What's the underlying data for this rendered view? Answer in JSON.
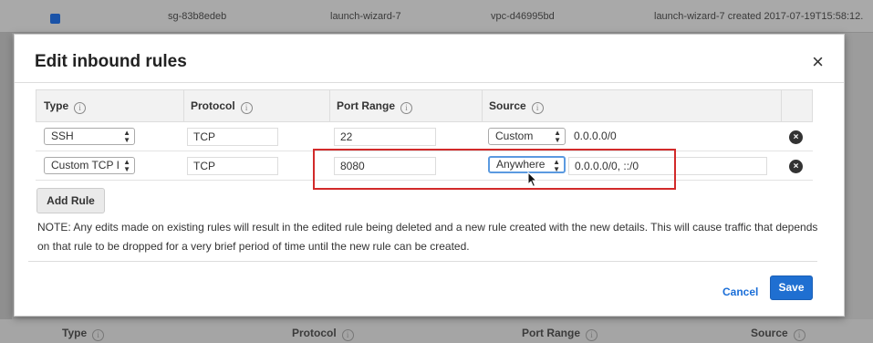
{
  "background": {
    "row": {
      "id": "sg-83b8edeb",
      "name": "launch-wizard-7",
      "vpc": "vpc-d46995bd",
      "description": "launch-wizard-7 created 2017-07-19T15:58:12."
    },
    "headers": [
      "Type",
      "Protocol",
      "Port Range",
      "Source"
    ]
  },
  "modal": {
    "title": "Edit inbound rules",
    "close_glyph": "×",
    "columns": [
      "Type",
      "Protocol",
      "Port Range",
      "Source"
    ],
    "info_glyph": "i",
    "rows": [
      {
        "type": "SSH",
        "protocol": "TCP",
        "port_range": "22",
        "source_type": "Custom",
        "source_value": "0.0.0.0/0"
      },
      {
        "type": "Custom TCP I",
        "protocol": "TCP",
        "port_range": "8080",
        "source_type": "Anywhere",
        "source_value": "0.0.0.0/0, ::/0"
      }
    ],
    "remove_glyph": "×",
    "add_rule_label": "Add Rule",
    "note": "NOTE: Any edits made on existing rules will result in the edited rule being deleted and a new rule created with the new details. This will cause traffic that depends on that rule to be dropped for a very brief period of time until the new rule can be created.",
    "cancel_label": "Cancel",
    "save_label": "Save"
  },
  "colors": {
    "primary": "#1f6fd1",
    "link": "#1a6ed8",
    "highlight": "#d22a2a"
  }
}
